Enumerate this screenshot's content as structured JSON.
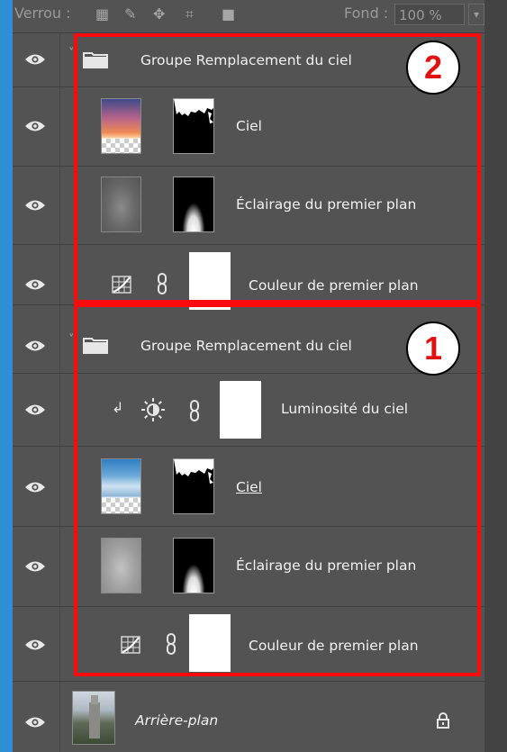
{
  "toolbar": {
    "lock_label": "Verrou :",
    "fill_label": "Fond :",
    "fill_value": "100 %"
  },
  "layers": [
    {
      "name": "Groupe Remplacement du ciel",
      "type": "group"
    },
    {
      "name": "Ciel",
      "type": "image-with-mask"
    },
    {
      "name": "Éclairage du premier plan",
      "type": "image-with-mask"
    },
    {
      "name": "Couleur de premier plan",
      "type": "curves-adjustment"
    },
    {
      "name": "Groupe Remplacement du ciel",
      "type": "group"
    },
    {
      "name": "Luminosité du ciel",
      "type": "brightness-adjustment-clipped"
    },
    {
      "name": "Ciel",
      "type": "image-with-mask",
      "underlined": true
    },
    {
      "name": "Éclairage du premier plan",
      "type": "image-with-mask"
    },
    {
      "name": "Couleur de premier plan",
      "type": "curves-adjustment"
    },
    {
      "name": "Arrière-plan",
      "type": "background-locked"
    }
  ],
  "annotations": {
    "badge_top": "2",
    "badge_bottom": "1",
    "box_color": "#ff0a0a"
  },
  "icons": [
    "eye-icon",
    "folder-icon",
    "chain-link-icon",
    "curves-icon",
    "brightness-icon",
    "clip-arrow-icon",
    "lock-icon"
  ]
}
